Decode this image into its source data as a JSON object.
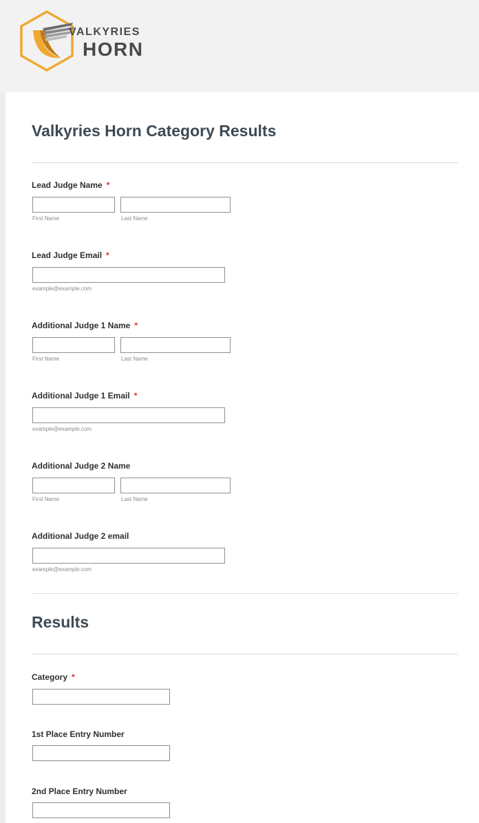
{
  "logo": {
    "line1": "VALKYRIES",
    "line2": "HORN",
    "accent": "#f0a830"
  },
  "form_title": "Valkyries Horn Category Results",
  "judges": {
    "lead_name": {
      "label": "Lead Judge Name",
      "required": "*",
      "first_sub": "First Name",
      "last_sub": "Last Name",
      "first_value": "",
      "last_value": ""
    },
    "lead_email": {
      "label": "Lead Judge Email",
      "required": "*",
      "sub": "example@example.com",
      "value": ""
    },
    "add1_name": {
      "label": "Additional Judge 1 Name",
      "required": "*",
      "first_sub": "First Name",
      "last_sub": "Last Name",
      "first_value": "",
      "last_value": ""
    },
    "add1_email": {
      "label": "Additional Judge 1 Email",
      "required": "*",
      "sub": "example@example.com",
      "value": ""
    },
    "add2_name": {
      "label": "Additional Judge 2 Name",
      "first_sub": "First Name",
      "last_sub": "Last Name",
      "first_value": "",
      "last_value": ""
    },
    "add2_email": {
      "label": "Additional Judge 2 email",
      "sub": "example@example.com",
      "value": ""
    }
  },
  "results": {
    "heading": "Results",
    "category": {
      "label": "Category",
      "required": "*",
      "value": ""
    },
    "first_place": {
      "label": "1st Place Entry Number",
      "value": ""
    },
    "second_place": {
      "label": "2nd Place Entry Number",
      "value": ""
    }
  },
  "colors": {
    "required": "#e0282b",
    "title": "#3e4a55",
    "header_bg": "#f2f2f2"
  }
}
